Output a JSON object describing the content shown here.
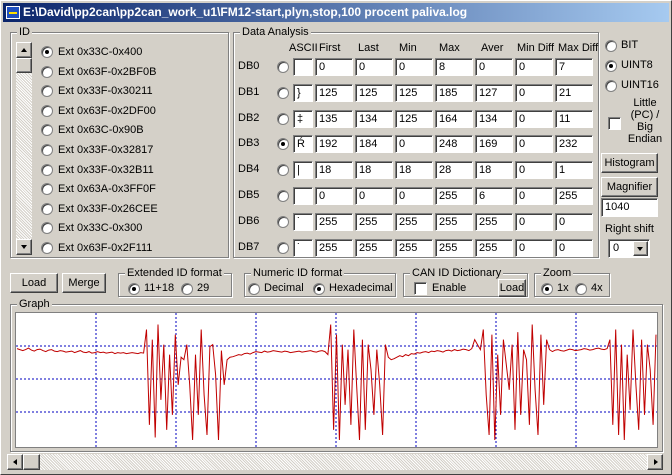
{
  "window": {
    "title": "E:\\David\\pp2can\\pp2can_work_u1\\FM12-start,plyn,stop,100 procent paliva.log"
  },
  "id_panel": {
    "label": "ID",
    "items": [
      {
        "label": "Ext 0x33C-0x400",
        "selected": true
      },
      {
        "label": "Ext 0x63F-0x2BF0B",
        "selected": false
      },
      {
        "label": "Ext 0x33F-0x30211",
        "selected": false
      },
      {
        "label": "Ext 0x63F-0x2DF00",
        "selected": false
      },
      {
        "label": "Ext 0x63C-0x90B",
        "selected": false
      },
      {
        "label": "Ext 0x33F-0x32817",
        "selected": false
      },
      {
        "label": "Ext 0x33F-0x32B11",
        "selected": false
      },
      {
        "label": "Ext 0x63A-0x3FF0F",
        "selected": false
      },
      {
        "label": "Ext 0x33F-0x26CEE",
        "selected": false
      },
      {
        "label": "Ext 0x33C-0x300",
        "selected": false
      },
      {
        "label": "Ext 0x63F-0x2F111",
        "selected": false
      }
    ]
  },
  "data_analysis": {
    "label": "Data Analysis",
    "headers": [
      "ASCII",
      "First",
      "Last",
      "Min",
      "Max",
      "Aver",
      "Min Diff",
      "Max Diff"
    ],
    "rows": [
      {
        "name": "DB0",
        "ascii": "",
        "values": [
          "0",
          "0",
          "0",
          "8",
          "0",
          "0",
          "7"
        ],
        "selected": false
      },
      {
        "name": "DB1",
        "ascii": "}",
        "values": [
          "125",
          "125",
          "125",
          "185",
          "127",
          "0",
          "21"
        ],
        "selected": false
      },
      {
        "name": "DB2",
        "ascii": "‡",
        "values": [
          "135",
          "134",
          "125",
          "164",
          "134",
          "0",
          "11"
        ],
        "selected": false
      },
      {
        "name": "DB3",
        "ascii": "Ŕ",
        "values": [
          "192",
          "184",
          "0",
          "248",
          "169",
          "0",
          "232"
        ],
        "selected": true
      },
      {
        "name": "DB4",
        "ascii": "|",
        "values": [
          "18",
          "18",
          "18",
          "28",
          "18",
          "0",
          "1"
        ],
        "selected": false
      },
      {
        "name": "DB5",
        "ascii": "",
        "values": [
          "0",
          "0",
          "0",
          "255",
          "6",
          "0",
          "255"
        ],
        "selected": false
      },
      {
        "name": "DB6",
        "ascii": "˙",
        "values": [
          "255",
          "255",
          "255",
          "255",
          "255",
          "0",
          "0"
        ],
        "selected": false
      },
      {
        "name": "DB7",
        "ascii": "˙",
        "values": [
          "255",
          "255",
          "255",
          "255",
          "255",
          "0",
          "0"
        ],
        "selected": false
      }
    ]
  },
  "format_options": [
    {
      "label": "BIT",
      "selected": false
    },
    {
      "label": "UINT8",
      "selected": true
    },
    {
      "label": "UINT16",
      "selected": false
    }
  ],
  "endian": {
    "label": "Little (PC) / Big Endian",
    "checked": false
  },
  "histogram_button": "Histogram",
  "magnifier_button": "Magnifier",
  "magnifier_value": "1040",
  "right_shift": {
    "label": "Right shift",
    "value": "0"
  },
  "load_button": "Load",
  "merge_button": "Merge",
  "extended_id": {
    "label": "Extended ID format",
    "options": [
      {
        "label": "11+18",
        "selected": true
      },
      {
        "label": "29",
        "selected": false
      }
    ]
  },
  "numeric_id": {
    "label": "Numeric ID format",
    "options": [
      {
        "label": "Decimal",
        "selected": false
      },
      {
        "label": "Hexadecimal",
        "selected": true
      }
    ]
  },
  "can_dict": {
    "label": "CAN ID Dictionary",
    "enable_label": "Enable",
    "enabled": false,
    "load_label": "Load"
  },
  "zoom": {
    "label": "Zoom",
    "options": [
      {
        "label": "1x",
        "selected": true
      },
      {
        "label": "4x",
        "selected": false
      }
    ]
  },
  "graph": {
    "label": "Graph",
    "line_color": "#c00000",
    "grid_color": "#0000c0"
  },
  "chart_data": {
    "type": "line",
    "ylim": [
      0,
      255
    ],
    "grid": true,
    "values": [
      192,
      190,
      188,
      190,
      193,
      189,
      187,
      190,
      191,
      188,
      186,
      189,
      190,
      187,
      186,
      188,
      187,
      185,
      186,
      187,
      184,
      186,
      188,
      185,
      184,
      186,
      183,
      184,
      186,
      184,
      185,
      183,
      184,
      185,
      182,
      184,
      183,
      184,
      182,
      183,
      184,
      183,
      182,
      184,
      183,
      230,
      40,
      210,
      15,
      240,
      90,
      200,
      30,
      180,
      60,
      220,
      120,
      175,
      170,
      200,
      120,
      10,
      180,
      60,
      230,
      100,
      20,
      196,
      200,
      140,
      10,
      188,
      120,
      170,
      175,
      176,
      178,
      180,
      179,
      182,
      183,
      181,
      184,
      186,
      185,
      184,
      187,
      185,
      186,
      188,
      187,
      186,
      185,
      187,
      186,
      184,
      185,
      186,
      187,
      185,
      186,
      187,
      188,
      186,
      185,
      187,
      188,
      186,
      180,
      240,
      30,
      220,
      10,
      200,
      80,
      190,
      40,
      230,
      120,
      10,
      210,
      30,
      200,
      150,
      60,
      190,
      120,
      20,
      200,
      175,
      170,
      172,
      175,
      178,
      176,
      180,
      178,
      182,
      181,
      184,
      183,
      185,
      186,
      184,
      187,
      186,
      188,
      187,
      185,
      188,
      189,
      187,
      190,
      188,
      189,
      191,
      190,
      188,
      192,
      210,
      200,
      190,
      230,
      100,
      20,
      220,
      10,
      180,
      60,
      210,
      160,
      110,
      200,
      30,
      225,
      60,
      190,
      170,
      40,
      240,
      110,
      20,
      220,
      80,
      210,
      190,
      186,
      189,
      190,
      188,
      187,
      189,
      191,
      190,
      188,
      189,
      190,
      192,
      191,
      189,
      190,
      192,
      193,
      191,
      190,
      192,
      210,
      40,
      230,
      20,
      200,
      10,
      180,
      70,
      230,
      120,
      30,
      210,
      60,
      200,
      150,
      40,
      220
    ]
  }
}
